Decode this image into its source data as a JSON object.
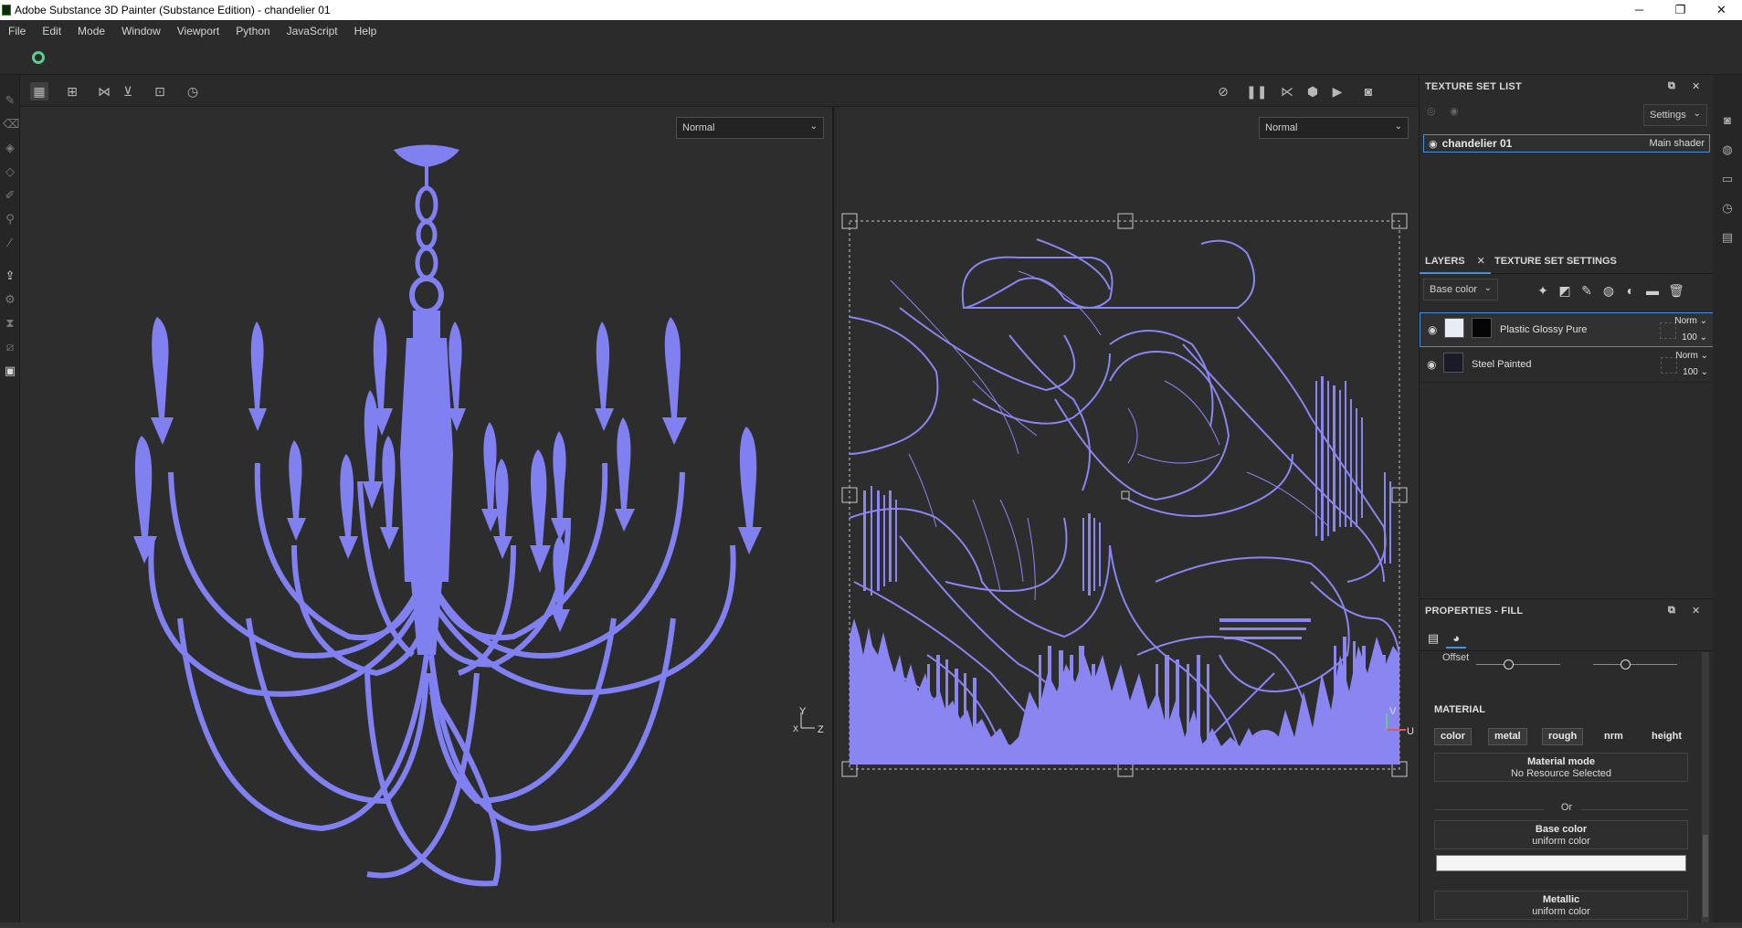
{
  "window": {
    "title": "Adobe Substance 3D Painter (Substance Edition) - chandelier 01",
    "controls": {
      "minimize": "─",
      "maximize": "❐",
      "close": "✕"
    }
  },
  "menu": [
    "File",
    "Edit",
    "Mode",
    "Window",
    "Viewport",
    "Python",
    "JavaScript",
    "Help"
  ],
  "viewport3d": {
    "mode": "Normal",
    "axis_y": "Y",
    "axis_x": "X",
    "axis_z": "Z"
  },
  "viewport2d": {
    "mode": "Normal",
    "axis_v": "V",
    "axis_u": "U"
  },
  "texture_set_list": {
    "title": "TEXTURE SET LIST",
    "settings_label": "Settings",
    "items": [
      {
        "name": "chandelier 01",
        "shader": "Main shader"
      }
    ]
  },
  "layers_panel": {
    "tab_layers": "LAYERS",
    "tab_tss": "TEXTURE SET SETTINGS",
    "channel": "Base color",
    "layers": [
      {
        "name": "Plastic Glossy Pure",
        "blend": "Norm",
        "opacity": "100",
        "selected": true
      },
      {
        "name": "Steel Painted",
        "blend": "Norm",
        "opacity": "100",
        "selected": false
      }
    ]
  },
  "properties": {
    "title": "PROPERTIES - FILL",
    "offset_label": "Offset",
    "material_title": "MATERIAL",
    "channels": [
      "color",
      "metal",
      "rough",
      "nrm",
      "height"
    ],
    "material_mode_label": "Material mode",
    "material_mode_value": "No Resource Selected",
    "or_label": "Or",
    "base_color_label": "Base color",
    "base_color_value": "uniform color",
    "metallic_label": "Metallic",
    "metallic_value": "uniform color"
  },
  "colors": {
    "accent": "#4a90d9",
    "mesh": "#8080f0",
    "uv": "#8a85f0"
  }
}
